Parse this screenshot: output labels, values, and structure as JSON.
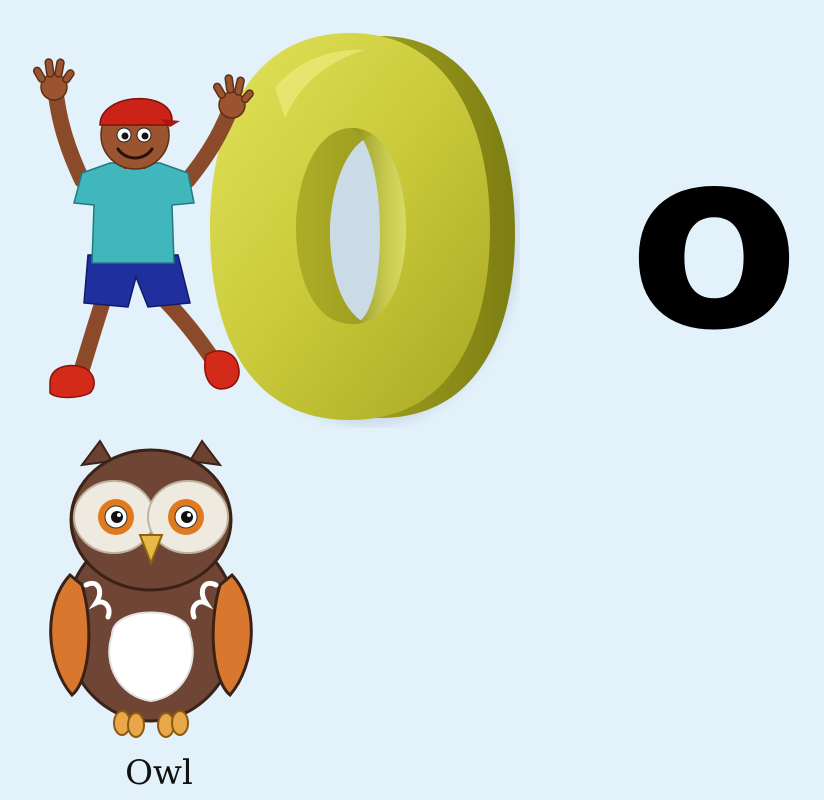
{
  "letter": {
    "uppercase": "O",
    "lowercase": "o"
  },
  "picture": {
    "caption": "Owl"
  },
  "colors": {
    "background": "#e3f1fb",
    "letter_3d": "#c9c93a",
    "letter_flat": "#000000"
  },
  "icons": [
    "boy-figure",
    "owl-illustration"
  ]
}
